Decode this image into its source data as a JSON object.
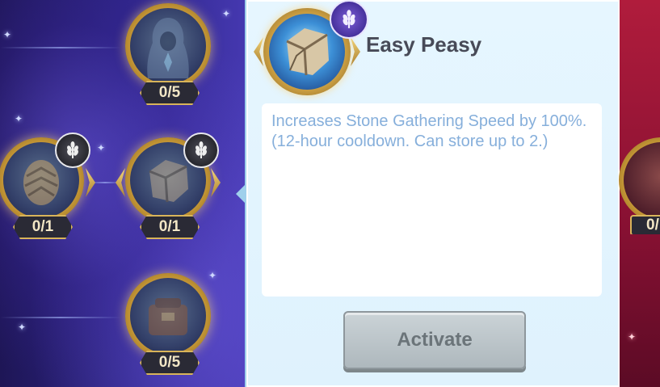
{
  "talent_tree": {
    "nodes": [
      {
        "id": "hooded-figure",
        "count": "0/5",
        "badge": false
      },
      {
        "id": "pinecone",
        "count": "0/1",
        "badge": true
      },
      {
        "id": "stone",
        "count": "0/1",
        "badge": true
      },
      {
        "id": "backpack",
        "count": "0/5",
        "badge": false
      }
    ],
    "right_partial_node": {
      "count": "0/"
    }
  },
  "detail_panel": {
    "title": "Easy Peasy",
    "description_line1": "Increases Stone Gathering Speed by 100%.",
    "description_line2": "(12-hour cooldown. Can store up to 2.)",
    "activate_label": "Activate",
    "activate_enabled": false,
    "icon": "stone-chunk-icon",
    "badge_icon": "wheat-icon"
  },
  "colors": {
    "panel_bg": "#e6f6ff",
    "description_text": "#86afdb",
    "title_text": "#474a57",
    "button_disabled": "#aeb8bd",
    "node_ring_gold": "#cfa244",
    "right_strip_red": "#b01c3c"
  }
}
